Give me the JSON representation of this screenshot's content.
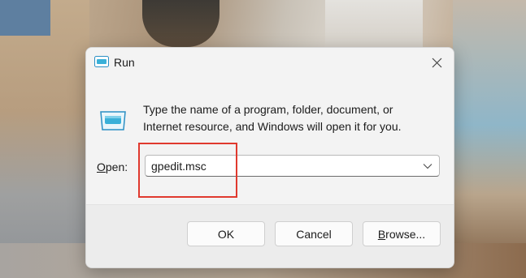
{
  "window": {
    "title": "Run",
    "title_icon": "run-icon",
    "close_icon": "close-icon"
  },
  "content": {
    "icon": "run-icon",
    "description_line1": "Type the name of a program, folder, document, or",
    "description_line2": "Internet resource, and Windows will open it for you."
  },
  "open_field": {
    "label_accel": "O",
    "label_rest": "pen:",
    "value": "gpedit.msc",
    "dropdown_icon": "chevron-down-icon"
  },
  "buttons": {
    "ok": "OK",
    "cancel": "Cancel",
    "browse_accel": "B",
    "browse_rest": "rowse..."
  },
  "colors": {
    "highlight": "#e0392e",
    "accent": "#3ab0d8"
  }
}
